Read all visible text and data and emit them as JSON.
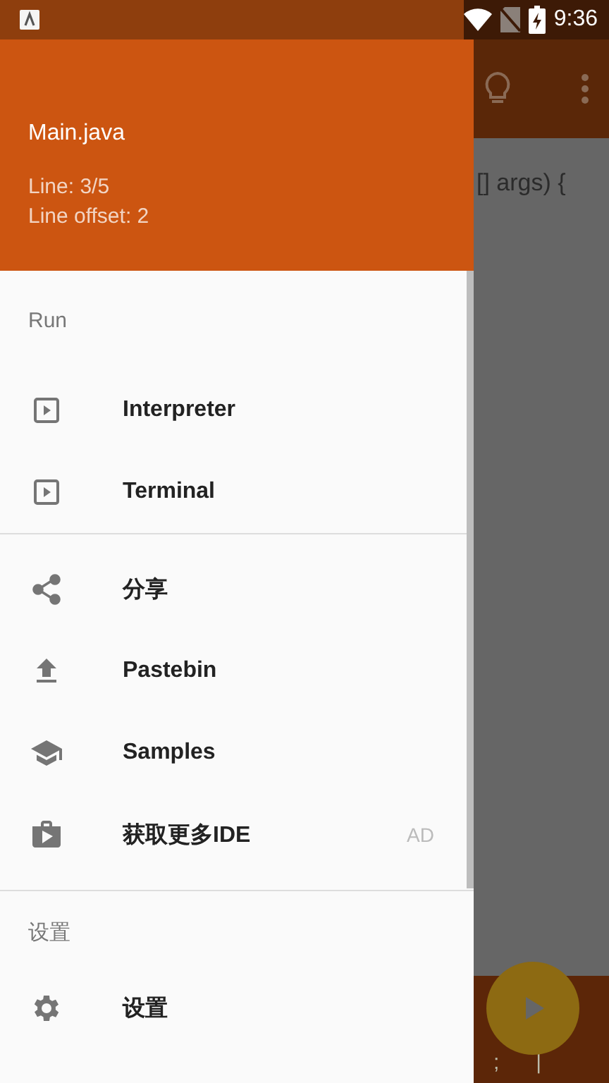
{
  "status_bar": {
    "time": "9:36"
  },
  "drawer": {
    "header": {
      "title": "Main.java",
      "lines": [
        "Line: 3/5",
        "Line offset: 2"
      ]
    },
    "sections": [
      {
        "title": "Run",
        "items": [
          {
            "kind": "play-box",
            "label": "Interpreter"
          },
          {
            "kind": "play-box",
            "label": "Terminal"
          }
        ]
      },
      {
        "items": [
          {
            "kind": "share",
            "label": "分享"
          },
          {
            "kind": "upload",
            "label": "Pastebin"
          },
          {
            "kind": "school",
            "label": "Samples"
          },
          {
            "kind": "shop",
            "label": "获取更多IDE",
            "badge": "AD"
          }
        ]
      },
      {
        "title": "设置",
        "items": [
          {
            "kind": "gear",
            "label": "设置"
          }
        ]
      }
    ]
  },
  "editor": {
    "code_line": "[] args) {"
  },
  "keys": [
    ";",
    "|"
  ]
}
